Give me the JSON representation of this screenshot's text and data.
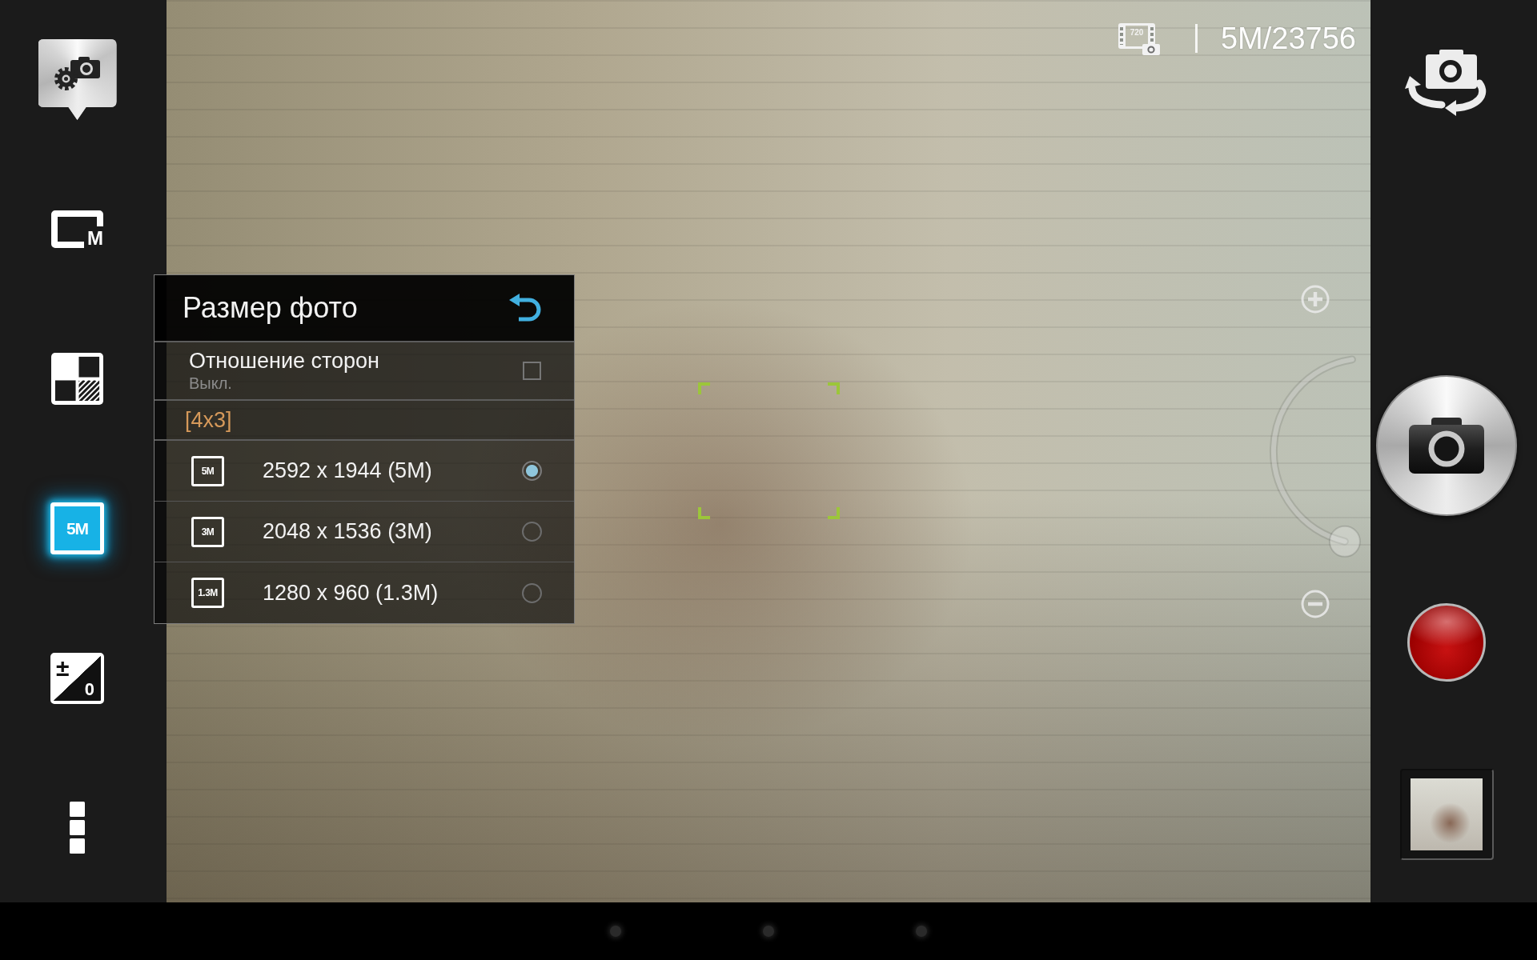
{
  "left_toolbar": {
    "items": [
      {
        "kind": "settings",
        "active": true,
        "selected": false
      },
      {
        "kind": "mode",
        "label": "M",
        "active": false,
        "selected": false
      },
      {
        "kind": "grid",
        "active": false,
        "selected": false
      },
      {
        "kind": "size",
        "label": "5M",
        "active": false,
        "selected": true
      },
      {
        "kind": "exposure",
        "sign": "±",
        "label": "0",
        "active": false,
        "selected": false
      },
      {
        "kind": "more",
        "active": false,
        "selected": false
      }
    ]
  },
  "size_menu": {
    "title": "Размер фото",
    "aspect_ratio": {
      "label": "Отношение сторон",
      "value": "Выкл.",
      "checked": false
    },
    "group": "[4x3]",
    "options": [
      {
        "badge": "5M",
        "label": "2592 x 1944 (5M)",
        "selected": true
      },
      {
        "badge": "3M",
        "label": "2048 x 1536 (3M)",
        "selected": false
      },
      {
        "badge": "1.3M",
        "label": "1280 x 960 (1.3M)",
        "selected": false
      }
    ]
  },
  "status": {
    "video_quality": "720",
    "remaining": "5M/23756"
  },
  "zoom": {
    "level": 0
  }
}
